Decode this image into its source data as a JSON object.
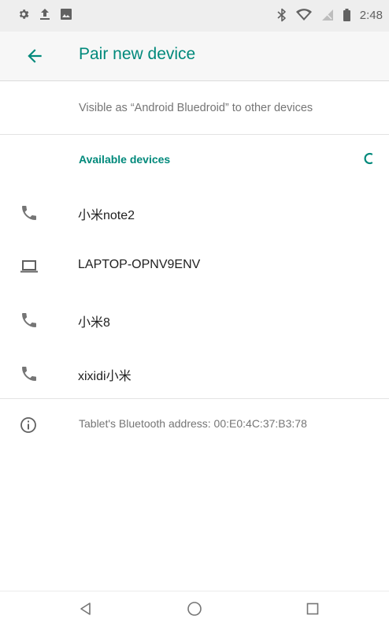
{
  "status_bar": {
    "left_icons": [
      "settings-gear-icon",
      "upload-icon",
      "image-icon"
    ],
    "right_icons": [
      "bluetooth-icon",
      "wifi-icon",
      "no-signal-icon",
      "battery-icon"
    ],
    "time": "2:48"
  },
  "header": {
    "back_icon": "arrow-left-icon",
    "title": "Pair new device"
  },
  "visibility": {
    "text": "Visible as “Android Bluedroid” to other devices"
  },
  "available": {
    "header": "Available devices",
    "devices": [
      {
        "name": "小米note2",
        "icon": "phone-icon"
      },
      {
        "name": "LAPTOP-OPNV9ENV",
        "icon": "laptop-icon"
      },
      {
        "name": "小米8",
        "icon": "phone-icon"
      },
      {
        "name": "xixidi小米",
        "icon": "phone-icon"
      }
    ]
  },
  "footer_info": {
    "icon": "info-icon",
    "text": "Tablet's Bluetooth address: 00:E0:4C:37:B3:78"
  },
  "nav": {
    "buttons": [
      "back-triangle-icon",
      "home-circle-icon",
      "recents-square-icon"
    ]
  },
  "colors": {
    "accent": "#00897b",
    "status_bar_bg": "#eeeeee",
    "secondary_text": "#757575"
  }
}
